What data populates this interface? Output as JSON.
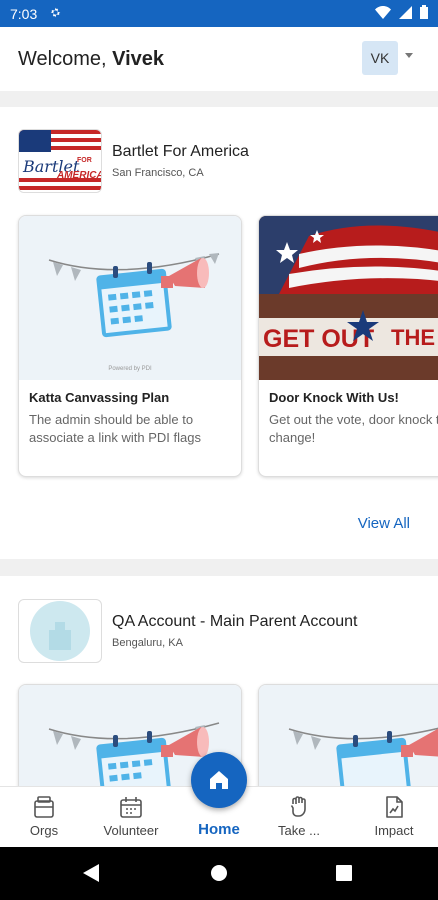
{
  "status_bar": {
    "time": "7:03"
  },
  "header": {
    "welcome_prefix": "Welcome, ",
    "user_name": "Vivek",
    "avatar_initials": "VK"
  },
  "orgs": [
    {
      "name": "Bartlet For America",
      "location": "San Francisco, CA",
      "logo_text_script": "Bartlet",
      "logo_text_for": "FOR",
      "logo_text_america": "AMERICA",
      "cards": [
        {
          "title": "Katta Canvassing Plan",
          "description_line1": "The admin should be able to",
          "description_line2": "associate a link with PDI flags",
          "powered_by": "Powered by PDI"
        },
        {
          "title": "Door Knock With Us!",
          "description_line1": "Get out the vote, door knock to create",
          "description_line2": "change!",
          "banner_text_1": "GET OUT",
          "banner_text_2": "THE W"
        }
      ],
      "view_all_label": "View All"
    },
    {
      "name": "QA Account - Main Parent Account",
      "location": "Bengaluru, KA"
    }
  ],
  "bottom_nav": [
    {
      "label": "Orgs",
      "icon": "building-icon"
    },
    {
      "label": "Volunteer",
      "icon": "calendar-icon"
    },
    {
      "label": "Home",
      "icon": "home-icon"
    },
    {
      "label": "Take ...",
      "icon": "raised-fist-icon"
    },
    {
      "label": "Impact",
      "icon": "document-chart-icon"
    }
  ],
  "colors": {
    "primary": "#1565c0",
    "accent": "#e57373",
    "calendar": "#4fb3e8"
  }
}
